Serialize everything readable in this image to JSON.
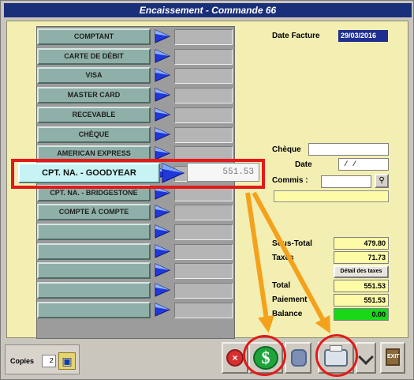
{
  "window": {
    "title": "Encaissement - Commande 66"
  },
  "payment_methods": [
    {
      "label": "COMPTANT"
    },
    {
      "label": "CARTE DE DÉBIT"
    },
    {
      "label": "VISA"
    },
    {
      "label": "MASTER CARD"
    },
    {
      "label": "RECEVABLE"
    },
    {
      "label": "CHÈQUE"
    },
    {
      "label": "AMERICAN EXPRESS"
    },
    {
      "label": ""
    },
    {
      "label": "CPT. NA. - BRIDGESTONE"
    },
    {
      "label": "COMPTE À COMPTE"
    },
    {
      "label": ""
    },
    {
      "label": ""
    },
    {
      "label": ""
    },
    {
      "label": ""
    },
    {
      "label": ""
    }
  ],
  "highlighted_method": {
    "label": "CPT. NA. - GOODYEAR",
    "amount": "551.53"
  },
  "invoice": {
    "date_label": "Date Facture",
    "date_value": "29/03/2016",
    "cheque_label": "Chèque",
    "date_field_label": "Date",
    "date_field_value": "/ /",
    "commis_label": "Commis :"
  },
  "totals": {
    "subtotal_label": "Sous-Total",
    "subtotal_value": "479.80",
    "taxes_label": "Taxes",
    "taxes_value": "71.73",
    "tax_detail_button": "Détail des taxes",
    "total_label": "Total",
    "total_value": "551.53",
    "payment_label": "Paiement",
    "payment_value": "551.53",
    "balance_label": "Balance",
    "balance_value": "0.00"
  },
  "bottom": {
    "copies_label": "Copies",
    "copies_value": "2"
  },
  "colors": {
    "title_bar": "#1a2f7a",
    "panel": "#f3efb3",
    "highlight": "#e21a1a",
    "annotation_arrow": "#f4a11c",
    "balance_ok": "#18d818"
  },
  "icons": {
    "arrow": "blue-play-arrow-icon",
    "disk": "save-disk-icon",
    "money": "dollar-icon",
    "printer": "printer-icon",
    "cancel": "cancel-icon",
    "exit": "exit-icon"
  }
}
